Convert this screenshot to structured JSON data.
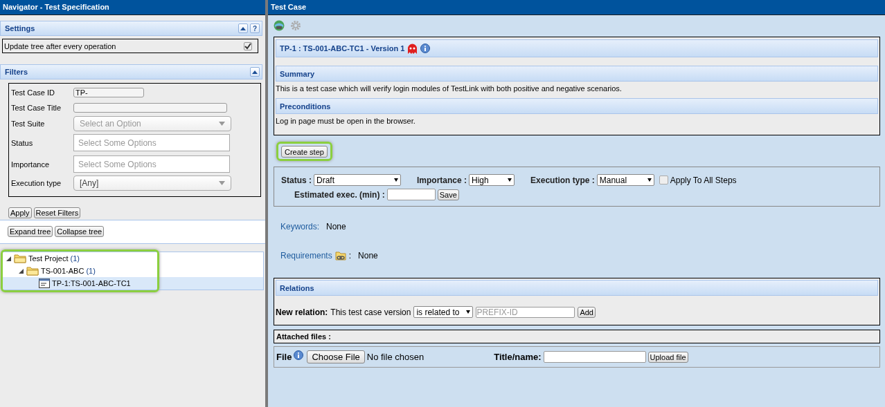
{
  "navigator": {
    "title": "Navigator - Test Specification",
    "settings": {
      "title": "Settings",
      "help": "?",
      "option": {
        "label": "Update tree after every operation",
        "checked": true
      }
    },
    "filters": {
      "title": "Filters",
      "fields": [
        {
          "label": "Test Case ID",
          "kind": "text",
          "value": "TP-"
        },
        {
          "label": "Test Case Title",
          "kind": "text"
        },
        {
          "label": "Test Suite",
          "kind": "select",
          "placeholder": "Select an Option"
        },
        {
          "label": "Status",
          "kind": "multi",
          "placeholder": "Select Some Options"
        },
        {
          "label": "Importance",
          "kind": "multi",
          "placeholder": "Select Some Options"
        },
        {
          "label": "Execution type",
          "kind": "select",
          "value": "[Any]"
        }
      ],
      "buttons": [
        "Apply",
        "Reset Filters"
      ]
    },
    "tree_buttons": [
      "Expand tree",
      "Collapse tree"
    ],
    "tree": [
      {
        "label": "Test Project",
        "count": "(1)",
        "kind": "folder",
        "expanded": true,
        "selected": false,
        "children": [
          {
            "label": "TS-001-ABC",
            "count": "(1)",
            "kind": "folder",
            "expanded": true,
            "selected": false,
            "children": [
              {
                "label": "TP-1:TS-001-ABC-TC1",
                "kind": "testcase",
                "selected": true
              }
            ]
          }
        ]
      }
    ]
  },
  "test_case": {
    "title": "Test Case",
    "header": "TP-1 : TS-001-ABC-TC1 - Version 1",
    "sections": [
      {
        "title": "Summary",
        "text": "This is a test case which will verify login modules of TestLink with both positive and negative scenarios."
      },
      {
        "title": "Preconditions",
        "text": "Log in page must be open in the browser."
      }
    ],
    "create_step": "Create step",
    "attributes": {
      "status": {
        "label": "Status :",
        "value": "Draft"
      },
      "importance": {
        "label": "Importance :",
        "value": "High"
      },
      "execution_type": {
        "label": "Execution type :",
        "value": "Manual"
      },
      "apply_all": {
        "label": "Apply To All Steps",
        "checked": false
      },
      "estimated": {
        "label": "Estimated exec. (min) :"
      },
      "save": "Save"
    },
    "keywords": {
      "label": "Keywords:",
      "value": "None"
    },
    "requirements": {
      "label": "Requirements",
      "separator": ":",
      "value": "None"
    },
    "relations": {
      "title": "Relations",
      "label": "New relation:",
      "text": "This test case version",
      "type": "is related to",
      "placeholder": "PREFIX-ID",
      "button": "Add"
    },
    "attached_files": "Attached files :",
    "upload": {
      "label": "File",
      "choose": "Choose File",
      "status": "No file chosen",
      "title_label": "Title/name:",
      "button": "Upload file"
    }
  }
}
